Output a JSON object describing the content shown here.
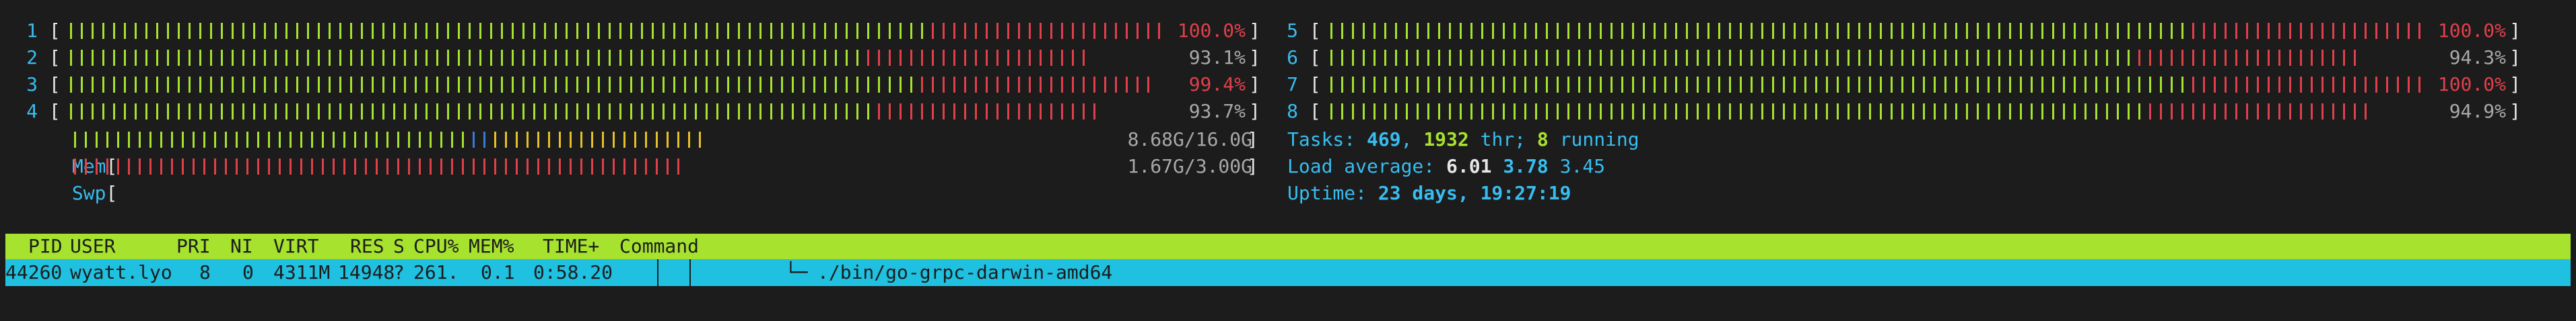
{
  "cpu_meters": [
    {
      "label": "1",
      "value": "100.0%",
      "percent": 100.0
    },
    {
      "label": "2",
      "value": "93.1%",
      "percent": 93.1
    },
    {
      "label": "3",
      "value": "99.4%",
      "percent": 99.4
    },
    {
      "label": "4",
      "value": "93.7%",
      "percent": 93.7
    },
    {
      "label": "5",
      "value": "100.0%",
      "percent": 100.0
    },
    {
      "label": "6",
      "value": "94.3%",
      "percent": 94.3
    },
    {
      "label": "7",
      "value": "100.0%",
      "percent": 100.0
    },
    {
      "label": "8",
      "value": "94.9%",
      "percent": 94.9
    }
  ],
  "mem": {
    "label": "Mem",
    "value": "8.68G/16.0G",
    "fraction": 0.5425
  },
  "swp": {
    "label": "Swp",
    "value": "1.67G/3.00G",
    "fraction": 0.557
  },
  "tasks": {
    "prefix": "Tasks: ",
    "count": "469",
    "sep1": ", ",
    "threads": "1932",
    "thr_label": " thr; ",
    "running": "8",
    "running_label": " running"
  },
  "load": {
    "prefix": "Load average: ",
    "one": "6.01",
    "five": "3.78",
    "fifteen": "3.45"
  },
  "uptime": {
    "prefix": "Uptime: ",
    "value": "23 days, 19:27:19"
  },
  "header": {
    "pid": "PID",
    "user": "USER",
    "pri": "PRI",
    "ni": "NI",
    "virt": "VIRT",
    "res": "RES",
    "s": "S",
    "cpu": "CPU%",
    "mem": "MEM%",
    "time": "TIME+",
    "command": "Command"
  },
  "process": {
    "pid": "44260",
    "user": "wyatt.lyo",
    "pri": "8",
    "ni": "0",
    "virt": "4311M",
    "res": "14948",
    "s": "?",
    "cpu": "261.",
    "mem": "0.1",
    "time": "0:58.20",
    "tree": "└─",
    "command": "./bin/go-grpc-darwin-amd64"
  },
  "colors": {
    "bg": "#1c1c1c",
    "label": "#38bdf0",
    "green_bar": "#a6e22e",
    "red_bar": "#e0404a",
    "mem_used": "#a6e22e",
    "mem_buffer": "#3a7bd5",
    "mem_cache": "#e6c02a",
    "header_bg": "#a6e22e",
    "selected_bg": "#1fc0e0",
    "value_red": "#e0404a"
  }
}
